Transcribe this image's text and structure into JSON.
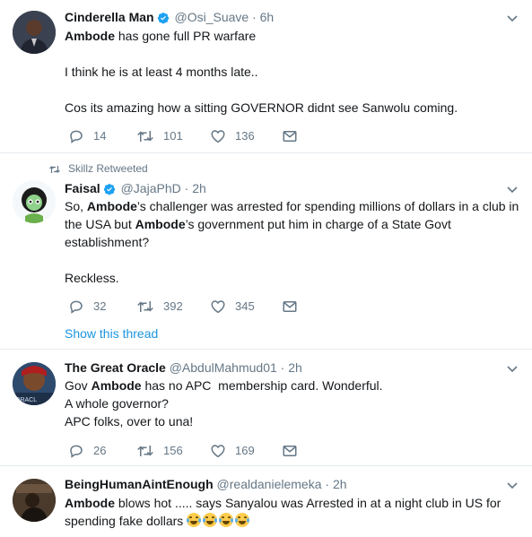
{
  "tweets": [
    {
      "name": "Cinderella Man",
      "handle": "@Osi_Suave",
      "dot": "·",
      "time": "6h",
      "lines": [
        [
          {
            "b": "Ambode"
          },
          {
            "t": " has gone full PR warfare"
          }
        ],
        [],
        [
          {
            "t": "I think he is at least 4 months late.."
          }
        ],
        [],
        [
          {
            "t": "Cos its amazing how a sitting GOVERNOR didnt see Sanwolu coming."
          }
        ]
      ],
      "replies": "14",
      "retweets": "101",
      "likes": "136"
    },
    {
      "retweet_context": "Skillz Retweeted",
      "name": "Faisal",
      "handle": "@JajaPhD",
      "dot": "·",
      "time": "2h",
      "lines": [
        [
          {
            "t": "So, "
          },
          {
            "b": "Ambode"
          },
          {
            "t": "’s challenger was arrested for spending millions of dollars in a club in"
          }
        ],
        [
          {
            "t": "the USA but "
          },
          {
            "b": "Ambode"
          },
          {
            "t": "’s government put him in charge of a State Govt"
          }
        ],
        [
          {
            "t": "establishment?"
          }
        ],
        [],
        [
          {
            "t": "Reckless."
          }
        ]
      ],
      "replies": "32",
      "retweets": "392",
      "likes": "345",
      "show_thread": "Show this thread"
    },
    {
      "name": "The Great Oracle",
      "handle": "@AbdulMahmud01",
      "dot": "·",
      "time": "2h",
      "lines": [
        [
          {
            "t": "Gov "
          },
          {
            "b": "Ambode"
          },
          {
            "t": " has no APC  membership card. Wonderful."
          }
        ],
        [
          {
            "t": "A whole governor?"
          }
        ],
        [
          {
            "t": "APC folks, over to una!"
          }
        ]
      ],
      "replies": "26",
      "retweets": "156",
      "likes": "169"
    },
    {
      "name": "BeingHumanAintEnough",
      "handle": "@realdanielemeka",
      "dot": "·",
      "time": "2h",
      "lines": [
        [
          {
            "b": "Ambode"
          },
          {
            "t": " blows hot ..... says Sanyalou was Arrested in at a night club in US for"
          }
        ],
        [
          {
            "t": "spending fake dollars "
          },
          {
            "e": "😂😂😂😂"
          }
        ]
      ]
    }
  ],
  "icons": {
    "verified": "verified-badge-icon",
    "caret": "chevron-down-icon",
    "reply": "reply-icon",
    "retweet": "retweet-icon",
    "like": "heart-icon",
    "dm": "envelope-icon"
  },
  "colors": {
    "link": "#1b95e0",
    "verified": "#1da1f2",
    "muted": "#657786",
    "divider": "#e6ecf0"
  }
}
